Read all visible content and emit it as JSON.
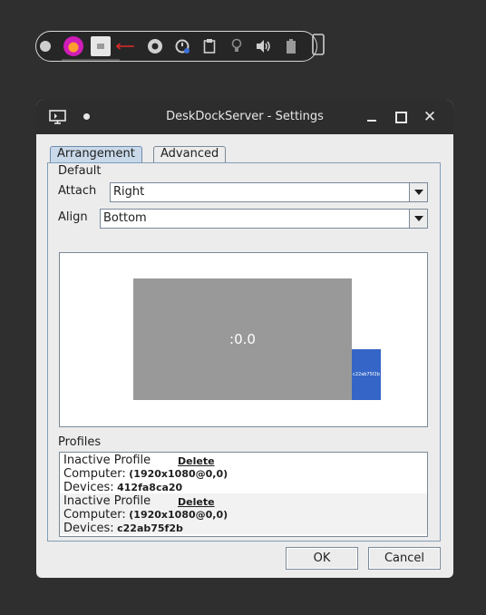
{
  "tray": {
    "icons": [
      "status-dot-icon",
      "firefox-icon",
      "screen-share-icon",
      "arrow-left-icon",
      "chrome-icon",
      "sync-icon",
      "clipboard-icon",
      "lightbulb-icon",
      "volume-icon",
      "battery-icon",
      "phone-icon"
    ]
  },
  "window": {
    "title": "DeskDockServer - Settings",
    "close_glyph": "✕"
  },
  "tabs": [
    {
      "label": "Arrangement"
    },
    {
      "label": "Advanced"
    }
  ],
  "default_section": {
    "heading": "Default",
    "attach_label": "Attach",
    "attach_value": "Right",
    "align_label": "Align",
    "align_value": "Bottom"
  },
  "arrangement": {
    "main_display_label": ":0.0",
    "device_display_label": "c22ab75f2b"
  },
  "profiles": {
    "heading": "Profiles",
    "items": [
      {
        "title": "Inactive Profile",
        "delete_label": "Delete",
        "computer_label": "Computer:",
        "computer_value": "(1920x1080@0,0)",
        "devices_label": "Devices:",
        "devices_value": "412fa8ca20"
      },
      {
        "title": "Inactive Profile",
        "delete_label": "Delete",
        "computer_label": "Computer:",
        "computer_value": "(1920x1080@0,0)",
        "devices_label": "Devices:",
        "devices_value": "c22ab75f2b"
      }
    ]
  },
  "buttons": {
    "ok": "OK",
    "cancel": "Cancel"
  },
  "colors": {
    "titlebar": "#2d2d2d",
    "main_display": "#999999",
    "device_display": "#3566c7",
    "tab_active": "#c9d9ea"
  }
}
